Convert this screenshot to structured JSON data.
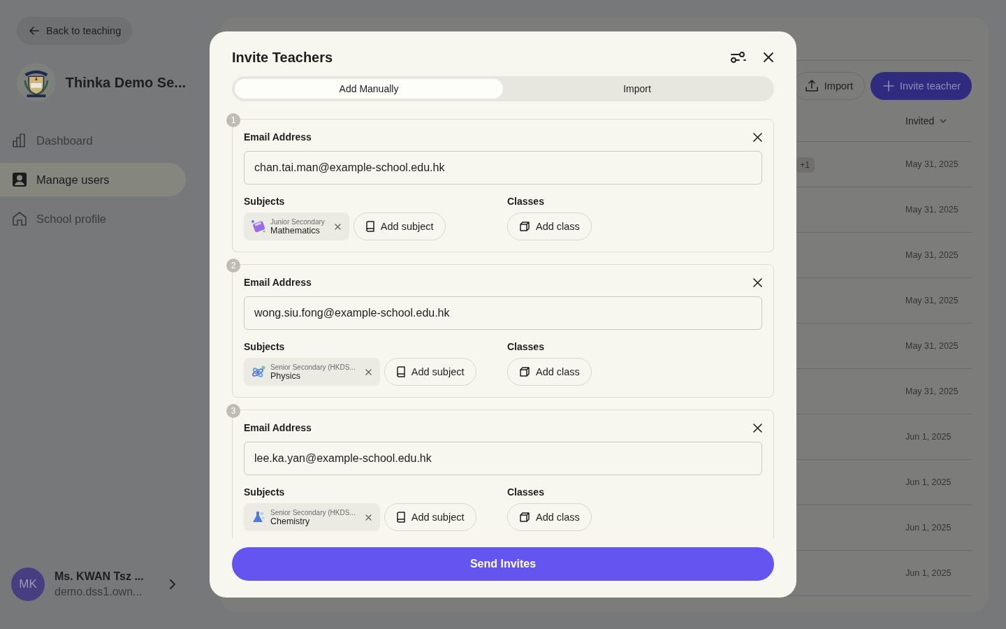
{
  "back_button": "Back to teaching",
  "school": {
    "name": "Thinka Demo Se..."
  },
  "nav": [
    {
      "label": "Dashboard",
      "kind": "chart",
      "selected": false
    },
    {
      "label": "Manage users",
      "kind": "user",
      "selected": true
    },
    {
      "label": "School profile",
      "kind": "home",
      "selected": false
    }
  ],
  "user": {
    "initials": "MK",
    "name": "Ms. KWAN Tsz ...",
    "email": "demo.dss1.own..."
  },
  "main": {
    "import_button": "Import",
    "invite_button": "Invite teacher",
    "table": {
      "columns": [
        "Invited"
      ],
      "rows": [
        {
          "badge": "+1",
          "invited": "May 31, 2025"
        },
        {
          "invited": "May 31, 2025"
        },
        {
          "invited": "May 31, 2025"
        },
        {
          "invited": "May 31, 2025"
        },
        {
          "invited": "May 31, 2025"
        },
        {
          "invited": "May 31, 2025"
        },
        {
          "invited": "Jun 1, 2025"
        },
        {
          "invited": "Jun 1, 2025"
        },
        {
          "invited": "Jun 1, 2025"
        },
        {
          "invited": "Jun 1, 2025"
        }
      ]
    }
  },
  "modal": {
    "title": "Invite Teachers",
    "tabs": [
      {
        "label": "Add Manually",
        "selected": true
      },
      {
        "label": "Import",
        "selected": false
      }
    ],
    "entries": [
      {
        "number": "1",
        "email_label": "Email Address",
        "email": "chan.tai.man@example-school.edu.hk",
        "subjects_label": "Subjects",
        "subjects": [
          {
            "kind": "calculator",
            "level": "Junior Secondary",
            "name": "Mathematics"
          }
        ],
        "add_subject": "Add subject",
        "classes_label": "Classes",
        "add_class": "Add class"
      },
      {
        "number": "2",
        "email_label": "Email Address",
        "email": "wong.siu.fong@example-school.edu.hk",
        "subjects_label": "Subjects",
        "subjects": [
          {
            "kind": "atom",
            "level": "Senior Secondary (HKDS...",
            "name": "Physics"
          }
        ],
        "add_subject": "Add subject",
        "classes_label": "Classes",
        "add_class": "Add class"
      },
      {
        "number": "3",
        "email_label": "Email Address",
        "email": "lee.ka.yan@example-school.edu.hk",
        "subjects_label": "Subjects",
        "subjects": [
          {
            "kind": "flask",
            "level": "Senior Secondary (HKDS...",
            "name": "Chemistry"
          }
        ],
        "add_subject": "Add subject",
        "classes_label": "Classes",
        "add_class": "Add class"
      }
    ],
    "send_button": "Send Invites"
  }
}
